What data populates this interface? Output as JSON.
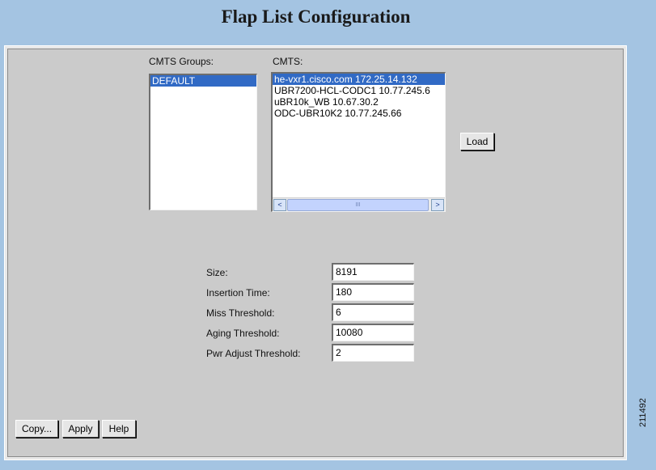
{
  "page": {
    "title": "Flap List Configuration",
    "figure_id": "211492"
  },
  "cmts_groups": {
    "label": "CMTS Groups:",
    "items": [
      {
        "label": "DEFAULT",
        "selected": true
      }
    ]
  },
  "cmts": {
    "label": "CMTS:",
    "items": [
      {
        "label": "he-vxr1.cisco.com 172.25.14.132",
        "selected": true
      },
      {
        "label": "UBR7200-HCL-CODC1 10.77.245.6",
        "selected": false
      },
      {
        "label": "uBR10k_WB 10.67.30.2",
        "selected": false
      },
      {
        "label": "ODC-UBR10K2 10.77.245.66",
        "selected": false
      }
    ],
    "scroll_left": "<",
    "scroll_right": ">",
    "scroll_thumb": "III"
  },
  "load_button": "Load",
  "fields": [
    {
      "label": "Size:",
      "value": "8191"
    },
    {
      "label": "Insertion Time:",
      "value": "180"
    },
    {
      "label": "Miss Threshold:",
      "value": "6"
    },
    {
      "label": "Aging Threshold:",
      "value": "10080"
    },
    {
      "label": "Pwr Adjust Threshold:",
      "value": "2"
    }
  ],
  "buttons": {
    "copy": "Copy...",
    "apply": "Apply",
    "help": "Help"
  },
  "colors": {
    "background": "#a4c4e2",
    "panel": "#cbcbcb",
    "selection": "#316ac5"
  }
}
